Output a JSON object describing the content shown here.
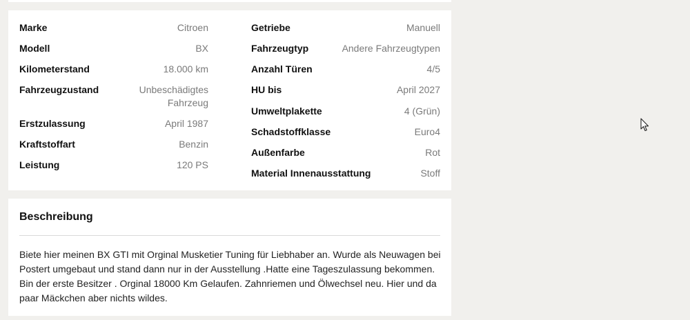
{
  "details": {
    "left": [
      {
        "key": "Marke",
        "value": "Citroen"
      },
      {
        "key": "Modell",
        "value": "BX"
      },
      {
        "key": "Kilometerstand",
        "value": "18.000 km"
      },
      {
        "key": "Fahrzeugzustand",
        "value": "Unbeschädigtes Fahrzeug"
      },
      {
        "key": "Erstzulassung",
        "value": "April 1987"
      },
      {
        "key": "Kraftstoffart",
        "value": "Benzin"
      },
      {
        "key": "Leistung",
        "value": "120 PS"
      }
    ],
    "right": [
      {
        "key": "Getriebe",
        "value": "Manuell"
      },
      {
        "key": "Fahrzeugtyp",
        "value": "Andere Fahrzeugtypen"
      },
      {
        "key": "Anzahl Türen",
        "value": "4/5"
      },
      {
        "key": "HU bis",
        "value": "April 2027"
      },
      {
        "key": "Umweltplakette",
        "value": "4 (Grün)"
      },
      {
        "key": "Schadstoffklasse",
        "value": "Euro4"
      },
      {
        "key": "Außenfarbe",
        "value": "Rot"
      },
      {
        "key": "Material Innenausstattung",
        "value": "Stoff"
      }
    ]
  },
  "description": {
    "title": "Beschreibung",
    "text": "Biete hier meinen BX GTI mit Orginal Musketier Tuning für Liebhaber an. Wurde als Neuwagen bei Postert umgebaut und stand dann nur in der Ausstellung .Hatte eine Tageszulassung bekommen. Bin der erste Besitzer . Orginal 18000 Km Gelaufen. Zahnriemen und Ölwechsel neu. Hier und da paar Mäckchen aber nichts wildes."
  },
  "icons": {
    "cursor": "mouse-pointer-icon"
  }
}
